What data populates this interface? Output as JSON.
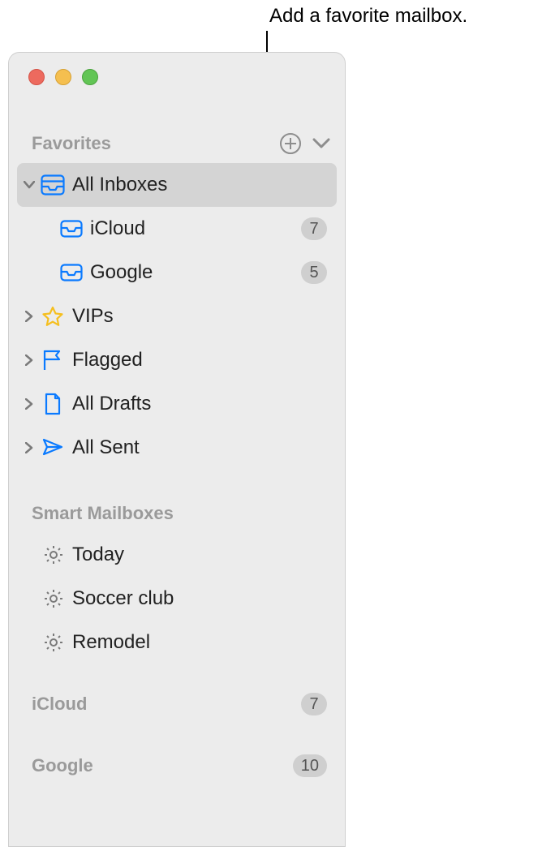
{
  "callout": "Add a favorite mailbox.",
  "sections": {
    "favorites": {
      "title": "Favorites",
      "items": [
        {
          "label": "All Inboxes"
        },
        {
          "label": "iCloud",
          "badge": "7"
        },
        {
          "label": "Google",
          "badge": "5"
        },
        {
          "label": "VIPs"
        },
        {
          "label": "Flagged"
        },
        {
          "label": "All Drafts"
        },
        {
          "label": "All Sent"
        }
      ]
    },
    "smart": {
      "title": "Smart Mailboxes",
      "items": [
        {
          "label": "Today"
        },
        {
          "label": "Soccer club"
        },
        {
          "label": "Remodel"
        }
      ]
    },
    "accounts": [
      {
        "label": "iCloud",
        "badge": "7"
      },
      {
        "label": "Google",
        "badge": "10"
      }
    ]
  }
}
